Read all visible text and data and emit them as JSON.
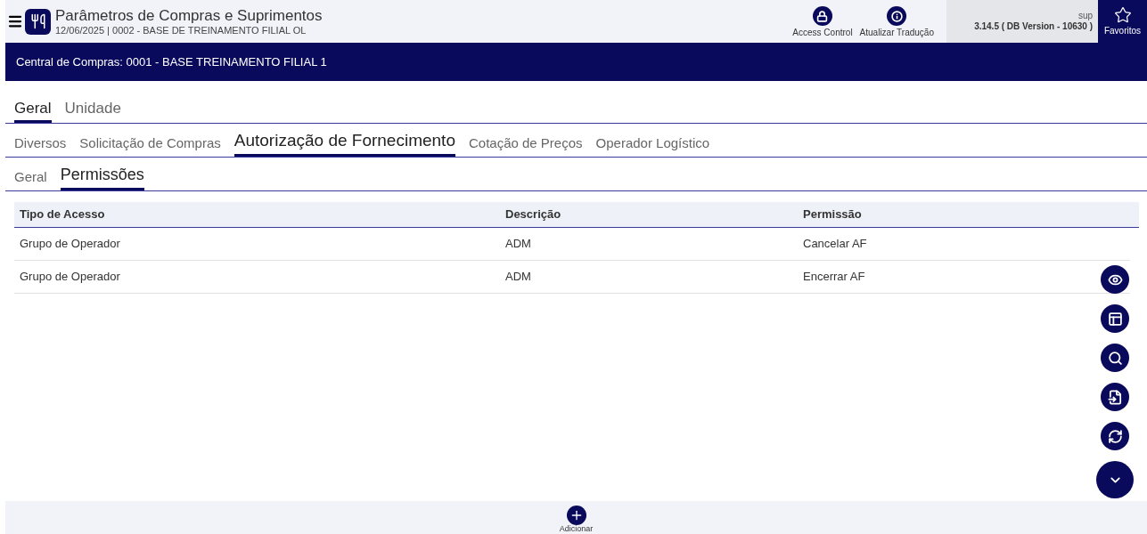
{
  "header": {
    "title": "Parâmetros de Compras e Suprimentos",
    "subtitle": "12/06/2025 | 0002 - BASE DE TREINAMENTO FILIAL OL",
    "actions": [
      {
        "kind": "lock",
        "label": "Access Control"
      },
      {
        "kind": "info",
        "label": "Atualizar Tradução"
      }
    ],
    "user": "sup",
    "version": "3.14.5 ( DB Version - 10630 )",
    "favorites": "Favoritos"
  },
  "banner": "Central de Compras: 0001 - BASE TREINAMENTO FILIAL 1",
  "tab_rows": [
    [
      {
        "label": "Geral",
        "selected": true
      },
      {
        "label": "Unidade",
        "selected": false
      }
    ],
    [
      {
        "label": "Diversos",
        "selected": false
      },
      {
        "label": "Solicitação de Compras",
        "selected": false
      },
      {
        "label": "Autorização de Fornecimento",
        "selected": true
      },
      {
        "label": "Cotação de Preços",
        "selected": false
      },
      {
        "label": "Operador Logístico",
        "selected": false
      }
    ],
    [
      {
        "label": "Geral",
        "selected": false
      },
      {
        "label": "Permissões",
        "selected": true
      }
    ]
  ],
  "table": {
    "columns": [
      "Tipo de Acesso",
      "Descrição",
      "Permissão"
    ],
    "rows": [
      [
        "Grupo de Operador",
        "ADM",
        "Cancelar AF"
      ],
      [
        "Grupo de Operador",
        "ADM",
        "Encerrar AF"
      ]
    ]
  },
  "side_actions": [
    {
      "kind": "eye"
    },
    {
      "kind": "layout"
    },
    {
      "kind": "search"
    },
    {
      "kind": "import"
    },
    {
      "kind": "refresh"
    },
    {
      "kind": "more"
    }
  ],
  "footer": {
    "add_label": "Adicionar"
  }
}
